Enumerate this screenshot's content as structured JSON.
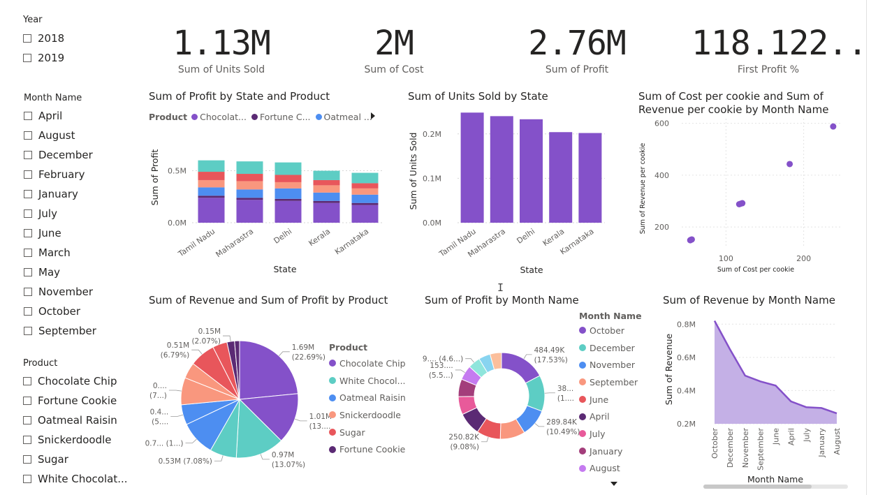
{
  "slicers": {
    "year": {
      "title": "Year",
      "items": [
        "2018",
        "2019"
      ]
    },
    "month": {
      "title": "Month Name",
      "items": [
        "April",
        "August",
        "December",
        "February",
        "January",
        "July",
        "June",
        "March",
        "May",
        "November",
        "October",
        "September"
      ]
    },
    "product": {
      "title": "Product",
      "items": [
        "Chocolate Chip",
        "Fortune Cookie",
        "Oatmeal Raisin",
        "Snickerdoodle",
        "Sugar",
        "White Chocolat..."
      ]
    }
  },
  "kpis": [
    {
      "value": "1.13M",
      "label": "Sum of Units Sold"
    },
    {
      "value": "2M",
      "label": "Sum of Cost"
    },
    {
      "value": "2.76M",
      "label": "Sum of Profit"
    },
    {
      "value": "118.122...",
      "label": "First Profit %"
    }
  ],
  "colors": {
    "chocolate_chip": "#8451C9",
    "white_chocolate": "#5DCDC4",
    "oatmeal_raisin": "#4D8EF1",
    "snickerdoodle": "#F9977E",
    "sugar": "#E8565B",
    "fortune_cookie": "#5B2A74",
    "april_dark": "#5B2A74",
    "july_pink": "#E85A9A",
    "january_plum": "#A33E7B",
    "august_lilac": "#C57BF0",
    "february_teal": "#8FE5DC",
    "march_sky": "#88D4F0",
    "may_peach": "#FBBF9C",
    "area_fill": "#C4B0E6"
  },
  "chart_data": [
    {
      "id": "profit_by_state_product",
      "type": "bar",
      "stacked": true,
      "title": "Sum of Profit by State and Product",
      "legend_title": "Product",
      "legend_items": [
        "Chocolat...",
        "Fortune C...",
        "Oatmeal ..."
      ],
      "xlabel": "State",
      "ylabel": "Sum of Profit",
      "categories": [
        "Tamil Nadu",
        "Maharastra",
        "Delhi",
        "Kerala",
        "Karnataka"
      ],
      "yticks": [
        "0.0M",
        "0.5M"
      ],
      "ylim": [
        0,
        0.9
      ],
      "series": [
        {
          "name": "Chocolate Chip",
          "color_key": "chocolate_chip",
          "values": [
            0.24,
            0.22,
            0.21,
            0.19,
            0.17
          ]
        },
        {
          "name": "Fortune Cookie",
          "color_key": "fortune_cookie",
          "values": [
            0.02,
            0.02,
            0.02,
            0.02,
            0.02
          ]
        },
        {
          "name": "Oatmeal Raisin",
          "color_key": "oatmeal_raisin",
          "values": [
            0.08,
            0.08,
            0.1,
            0.08,
            0.08
          ]
        },
        {
          "name": "Snickerdoodle",
          "color_key": "snickerdoodle",
          "values": [
            0.07,
            0.08,
            0.06,
            0.07,
            0.06
          ]
        },
        {
          "name": "Sugar",
          "color_key": "sugar",
          "values": [
            0.08,
            0.07,
            0.07,
            0.05,
            0.05
          ]
        },
        {
          "name": "White Chocolate",
          "color_key": "white_chocolate",
          "values": [
            0.11,
            0.12,
            0.12,
            0.09,
            0.1
          ]
        }
      ]
    },
    {
      "id": "units_by_state",
      "type": "bar",
      "title": "Sum of Units Sold by State",
      "xlabel": "State",
      "ylabel": "Sum of Units Sold",
      "categories": [
        "Tamil Nadu",
        "Maharastra",
        "Delhi",
        "Kerala",
        "Karnataka"
      ],
      "values": [
        0.248,
        0.24,
        0.233,
        0.204,
        0.202
      ],
      "yticks": [
        "0.0M",
        "0.1M",
        "0.2M"
      ],
      "ylim": [
        0,
        0.25
      ]
    },
    {
      "id": "cost_vs_revenue",
      "type": "scatter",
      "title": "Sum of Cost per cookie and Sum of Revenue per cookie by Month Name",
      "title_lines": [
        "Sum of Cost per cookie and Sum of",
        "Revenue per cookie by Month Name"
      ],
      "xlabel": "Sum of Cost per cookie",
      "ylabel": "Sum of Revenue per cookie",
      "xticks": [
        "100",
        "200"
      ],
      "yticks": [
        "200",
        "400",
        "600"
      ],
      "xlim": [
        43,
        248
      ],
      "ylim": [
        125,
        618
      ],
      "points": [
        {
          "x": 54,
          "y": 149
        },
        {
          "x": 55,
          "y": 151
        },
        {
          "x": 56,
          "y": 152
        },
        {
          "x": 117,
          "y": 288
        },
        {
          "x": 119,
          "y": 290
        },
        {
          "x": 121,
          "y": 292
        },
        {
          "x": 182,
          "y": 443
        },
        {
          "x": 238,
          "y": 588
        }
      ]
    },
    {
      "id": "revenue_profit_by_product",
      "type": "pie",
      "title": "Sum of Revenue and Sum of Profit by Product",
      "legend_title": "Product",
      "legend_items": [
        "Chocolate Chip",
        "White Chocol...",
        "Oatmeal Raisin",
        "Snickerdoodle",
        "Sugar",
        "Fortune Cookie"
      ],
      "legend_color_keys": [
        "chocolate_chip",
        "white_chocolate",
        "oatmeal_raisin",
        "snickerdoodle",
        "sugar",
        "fortune_cookie"
      ],
      "slices": [
        {
          "product": "Chocolate Chip",
          "measure": "Revenue",
          "value": 1.69,
          "pct": 22.69,
          "color_key": "chocolate_chip",
          "label": [
            "1.69M",
            "(22.69%)"
          ]
        },
        {
          "product": "Chocolate Chip",
          "measure": "Profit",
          "value": 1.01,
          "pct": 13.58,
          "color_key": "chocolate_chip",
          "label": [
            "1.01M",
            "(13...."
          ]
        },
        {
          "product": "White Chocolate",
          "measure": "Revenue",
          "value": 0.97,
          "pct": 13.07,
          "color_key": "white_chocolate",
          "label": [
            "0.97M",
            "(13.07%)"
          ]
        },
        {
          "product": "White Chocolate",
          "measure": "Profit",
          "value": 0.53,
          "pct": 7.08,
          "color_key": "white_chocolate",
          "label": [
            "0.53M (7.08%)"
          ]
        },
        {
          "product": "Oatmeal Raisin",
          "measure": "Revenue",
          "value": 0.7,
          "pct": 9.4,
          "color_key": "oatmeal_raisin",
          "label": [
            "0.7... (1...)"
          ]
        },
        {
          "product": "Oatmeal Raisin",
          "measure": "Profit",
          "value": 0.4,
          "pct": 5.4,
          "color_key": "oatmeal_raisin",
          "label": [
            "0.4...",
            "(5...."
          ]
        },
        {
          "product": "Snickerdoodle",
          "measure": "Revenue",
          "value": 0.54,
          "pct": 7.3,
          "color_key": "snickerdoodle",
          "label": [
            "0....",
            "(7...)"
          ]
        },
        {
          "product": "Snickerdoodle",
          "measure": "Profit",
          "value": 0.32,
          "pct": 4.3,
          "color_key": "snickerdoodle",
          "label": []
        },
        {
          "product": "Sugar",
          "measure": "Revenue",
          "value": 0.51,
          "pct": 6.79,
          "color_key": "sugar",
          "label": [
            "0.51M",
            "(6.79%)"
          ]
        },
        {
          "product": "Sugar",
          "measure": "Profit",
          "value": 0.29,
          "pct": 3.9,
          "color_key": "sugar",
          "label": []
        },
        {
          "product": "Fortune Cookie",
          "measure": "Revenue",
          "value": 0.15,
          "pct": 2.07,
          "color_key": "fortune_cookie",
          "label": [
            "0.15M",
            "(2.07%)"
          ]
        },
        {
          "product": "Fortune Cookie",
          "measure": "Profit",
          "value": 0.1,
          "pct": 1.4,
          "color_key": "fortune_cookie",
          "label": []
        }
      ]
    },
    {
      "id": "profit_by_month",
      "type": "pie",
      "donut": true,
      "title": "Sum of Profit by Month Name",
      "legend_title": "Month Name",
      "legend_items": [
        "October",
        "December",
        "November",
        "September",
        "June",
        "April",
        "July",
        "January",
        "August"
      ],
      "legend_color_keys": [
        "chocolate_chip",
        "white_chocolate",
        "oatmeal_raisin",
        "snickerdoodle",
        "sugar",
        "april_dark",
        "july_pink",
        "january_plum",
        "august_lilac"
      ],
      "slices": [
        {
          "name": "October",
          "value": 484.49,
          "pct": 17.53,
          "color_key": "chocolate_chip",
          "label": [
            "484.49K",
            "(17.53%)"
          ]
        },
        {
          "name": "December",
          "value": 380,
          "pct": 13.7,
          "color_key": "white_chocolate",
          "label": [
            "38...",
            "(1...."
          ]
        },
        {
          "name": "November",
          "value": 289.84,
          "pct": 10.49,
          "color_key": "oatmeal_raisin",
          "label": [
            "289.84K",
            "(10.49%)"
          ]
        },
        {
          "name": "September",
          "value": 262,
          "pct": 9.5,
          "color_key": "snickerdoodle",
          "label": []
        },
        {
          "name": "June",
          "value": 250.82,
          "pct": 9.08,
          "color_key": "sugar",
          "label": [
            "250.82K",
            "(9.08%)"
          ]
        },
        {
          "name": "April",
          "value": 240,
          "pct": 8.7,
          "color_key": "april_dark",
          "label": []
        },
        {
          "name": "July",
          "value": 190,
          "pct": 6.9,
          "color_key": "july_pink",
          "label": []
        },
        {
          "name": "January",
          "value": 185,
          "pct": 6.7,
          "color_key": "january_plum",
          "label": []
        },
        {
          "name": "August",
          "value": 153,
          "pct": 5.5,
          "color_key": "august_lilac",
          "label": [
            "153....",
            "(5.5...)"
          ]
        },
        {
          "name": "February",
          "value": 129,
          "pct": 4.6,
          "color_key": "february_teal",
          "label": [
            "129.... (4.6...)"
          ]
        },
        {
          "name": "March",
          "value": 123,
          "pct": 4.5,
          "color_key": "march_sky",
          "label": []
        },
        {
          "name": "May",
          "value": 120,
          "pct": 4.3,
          "color_key": "may_peach",
          "label": []
        }
      ]
    },
    {
      "id": "revenue_by_month",
      "type": "area",
      "title": "Sum of Revenue by Month Name",
      "xlabel": "Month Name",
      "ylabel": "Sum of Revenue",
      "categories": [
        "October",
        "December",
        "November",
        "September",
        "June",
        "April",
        "July",
        "January",
        "August"
      ],
      "values": [
        0.82,
        0.65,
        0.49,
        0.455,
        0.43,
        0.335,
        0.3,
        0.295,
        0.263
      ],
      "yticks": [
        "0.2M",
        "0.4M",
        "0.6M",
        "0.8M"
      ],
      "ylim": [
        0.2,
        0.86
      ]
    }
  ]
}
